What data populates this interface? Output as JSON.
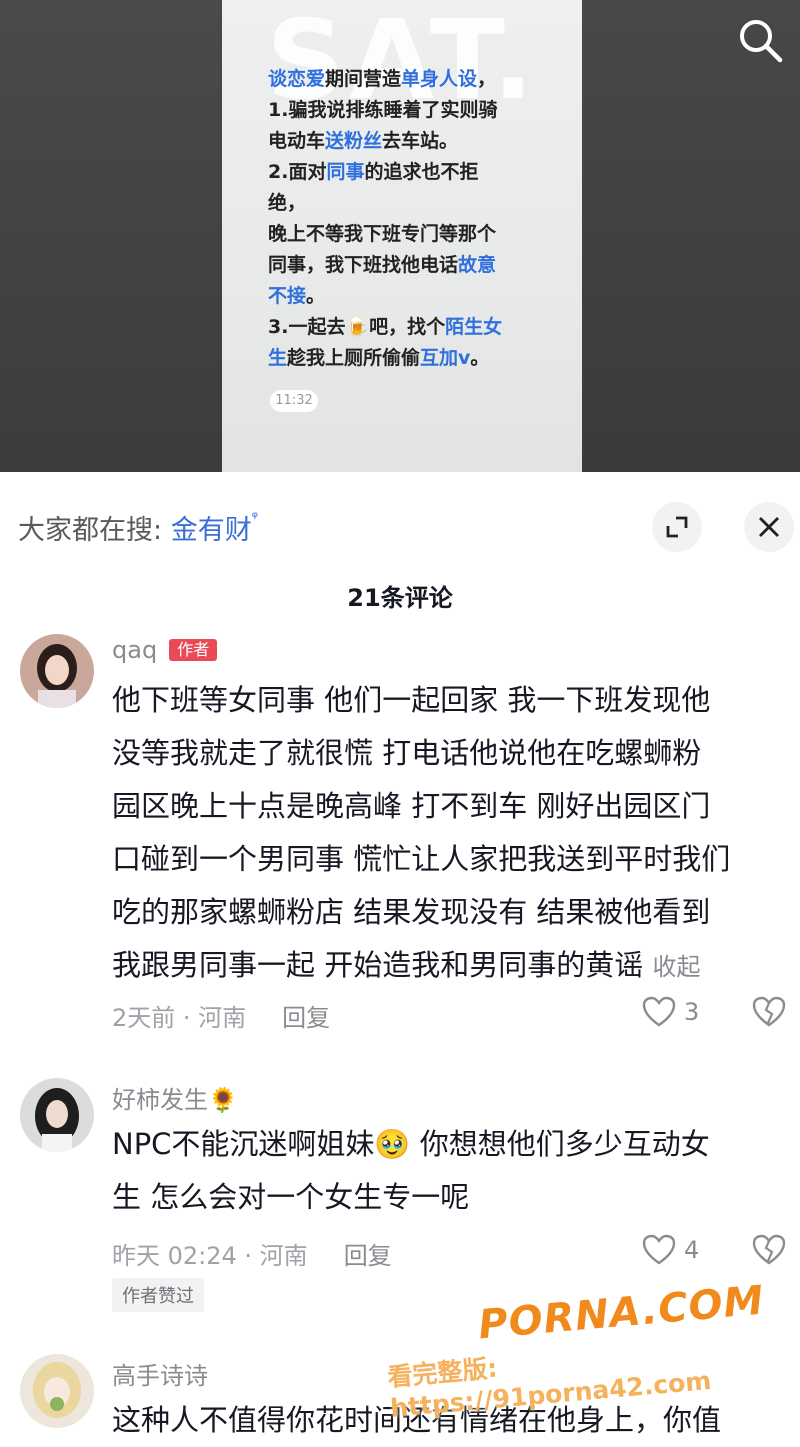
{
  "video": {
    "watermark": "SAT.",
    "lines": [
      [
        {
          "t": "谈恋爱",
          "h": true
        },
        {
          "t": "期间营造",
          "h": false
        },
        {
          "t": "单身人设",
          "h": true
        },
        {
          "t": "，",
          "h": false
        }
      ],
      [
        {
          "t": "1.骗我说排练睡着了实则骑",
          "h": false
        }
      ],
      [
        {
          "t": "电动车",
          "h": false
        },
        {
          "t": "送粉丝",
          "h": true
        },
        {
          "t": "去车站。",
          "h": false
        }
      ],
      [
        {
          "t": "2.面对",
          "h": false
        },
        {
          "t": "同事",
          "h": true
        },
        {
          "t": "的追求也不拒",
          "h": false
        }
      ],
      [
        {
          "t": "绝，",
          "h": false
        }
      ],
      [
        {
          "t": "晚上不等我下班专门等那个",
          "h": false
        }
      ],
      [
        {
          "t": "同事，我下班找他电话",
          "h": false
        },
        {
          "t": "故意",
          "h": true
        }
      ],
      [
        {
          "t": "不接",
          "h": true
        },
        {
          "t": "。",
          "h": false
        }
      ],
      [
        {
          "t": "3.一起去",
          "h": false
        },
        {
          "t": "🍺",
          "h": false
        },
        {
          "t": "吧，找个",
          "h": false
        },
        {
          "t": "陌生女",
          "h": true
        }
      ],
      [
        {
          "t": "生",
          "h": true
        },
        {
          "t": "趁我上厕所偷偷",
          "h": false
        },
        {
          "t": "互加v",
          "h": true
        },
        {
          "t": "。",
          "h": false
        }
      ]
    ],
    "time": "11:32"
  },
  "hot_search": {
    "prefix": "大家都在搜:",
    "keyword": "金有财"
  },
  "comments_title": "21条评论",
  "comments": [
    {
      "user": "qaq",
      "tag": "作者",
      "lines": [
        "他下班等女同事 他们一起回家 我一下班发现他",
        "没等我就走了就很慌 打电话他说他在吃螺蛳粉",
        "园区晚上十点是晚高峰 打不到车 刚好出园区门",
        "口碰到一个男同事 慌忙让人家把我送到平时我们",
        "吃的那家螺蛳粉店 结果发现没有 结果被他看到",
        "我跟男同事一起 开始造我和男同事的黄谣"
      ],
      "collapse": "收起",
      "meta": "2天前 · 河南",
      "reply": "回复",
      "likes": "3"
    },
    {
      "user": "好柿发生🌻",
      "lines": [
        "NPC不能沉迷啊姐妹🥹 你想想他们多少互动女",
        "生 怎么会对一个女生专一呢"
      ],
      "meta": "昨天 02:24 · 河南",
      "reply": "回复",
      "likes": "4",
      "liked_tag": "作者赞过"
    },
    {
      "user": "高手诗诗",
      "lines": [
        "这种人不值得你花时间还有情绪在他身上，你值"
      ]
    }
  ],
  "watermark": {
    "brand": "PORNA.COM",
    "url": "看完整版: https://91porna42.com"
  }
}
